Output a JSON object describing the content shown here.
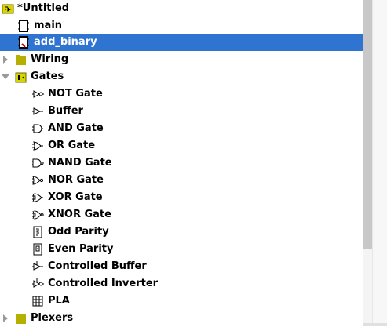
{
  "tree": {
    "project": {
      "title": "*Untitled"
    },
    "circuits": [
      {
        "label": "main"
      },
      {
        "label": "add_binary"
      }
    ],
    "folders": {
      "wiring": "Wiring",
      "gates": "Gates",
      "plexers": "Plexers"
    },
    "gates": [
      {
        "label": "NOT Gate",
        "icon": "not-gate-icon"
      },
      {
        "label": "Buffer",
        "icon": "buffer-icon"
      },
      {
        "label": "AND Gate",
        "icon": "and-gate-icon"
      },
      {
        "label": "OR Gate",
        "icon": "or-gate-icon"
      },
      {
        "label": "NAND Gate",
        "icon": "nand-gate-icon"
      },
      {
        "label": "NOR Gate",
        "icon": "nor-gate-icon"
      },
      {
        "label": "XOR Gate",
        "icon": "xor-gate-icon"
      },
      {
        "label": "XNOR Gate",
        "icon": "xnor-gate-icon"
      },
      {
        "label": "Odd Parity",
        "icon": "odd-parity-icon"
      },
      {
        "label": "Even Parity",
        "icon": "even-parity-icon"
      },
      {
        "label": "Controlled Buffer",
        "icon": "controlled-buffer-icon"
      },
      {
        "label": "Controlled Inverter",
        "icon": "controlled-inverter-icon"
      },
      {
        "label": "PLA",
        "icon": "pla-icon"
      }
    ]
  },
  "colors": {
    "selection": "#2f74d0",
    "folder": "#b5b000",
    "expander": "#9a9a9a"
  }
}
